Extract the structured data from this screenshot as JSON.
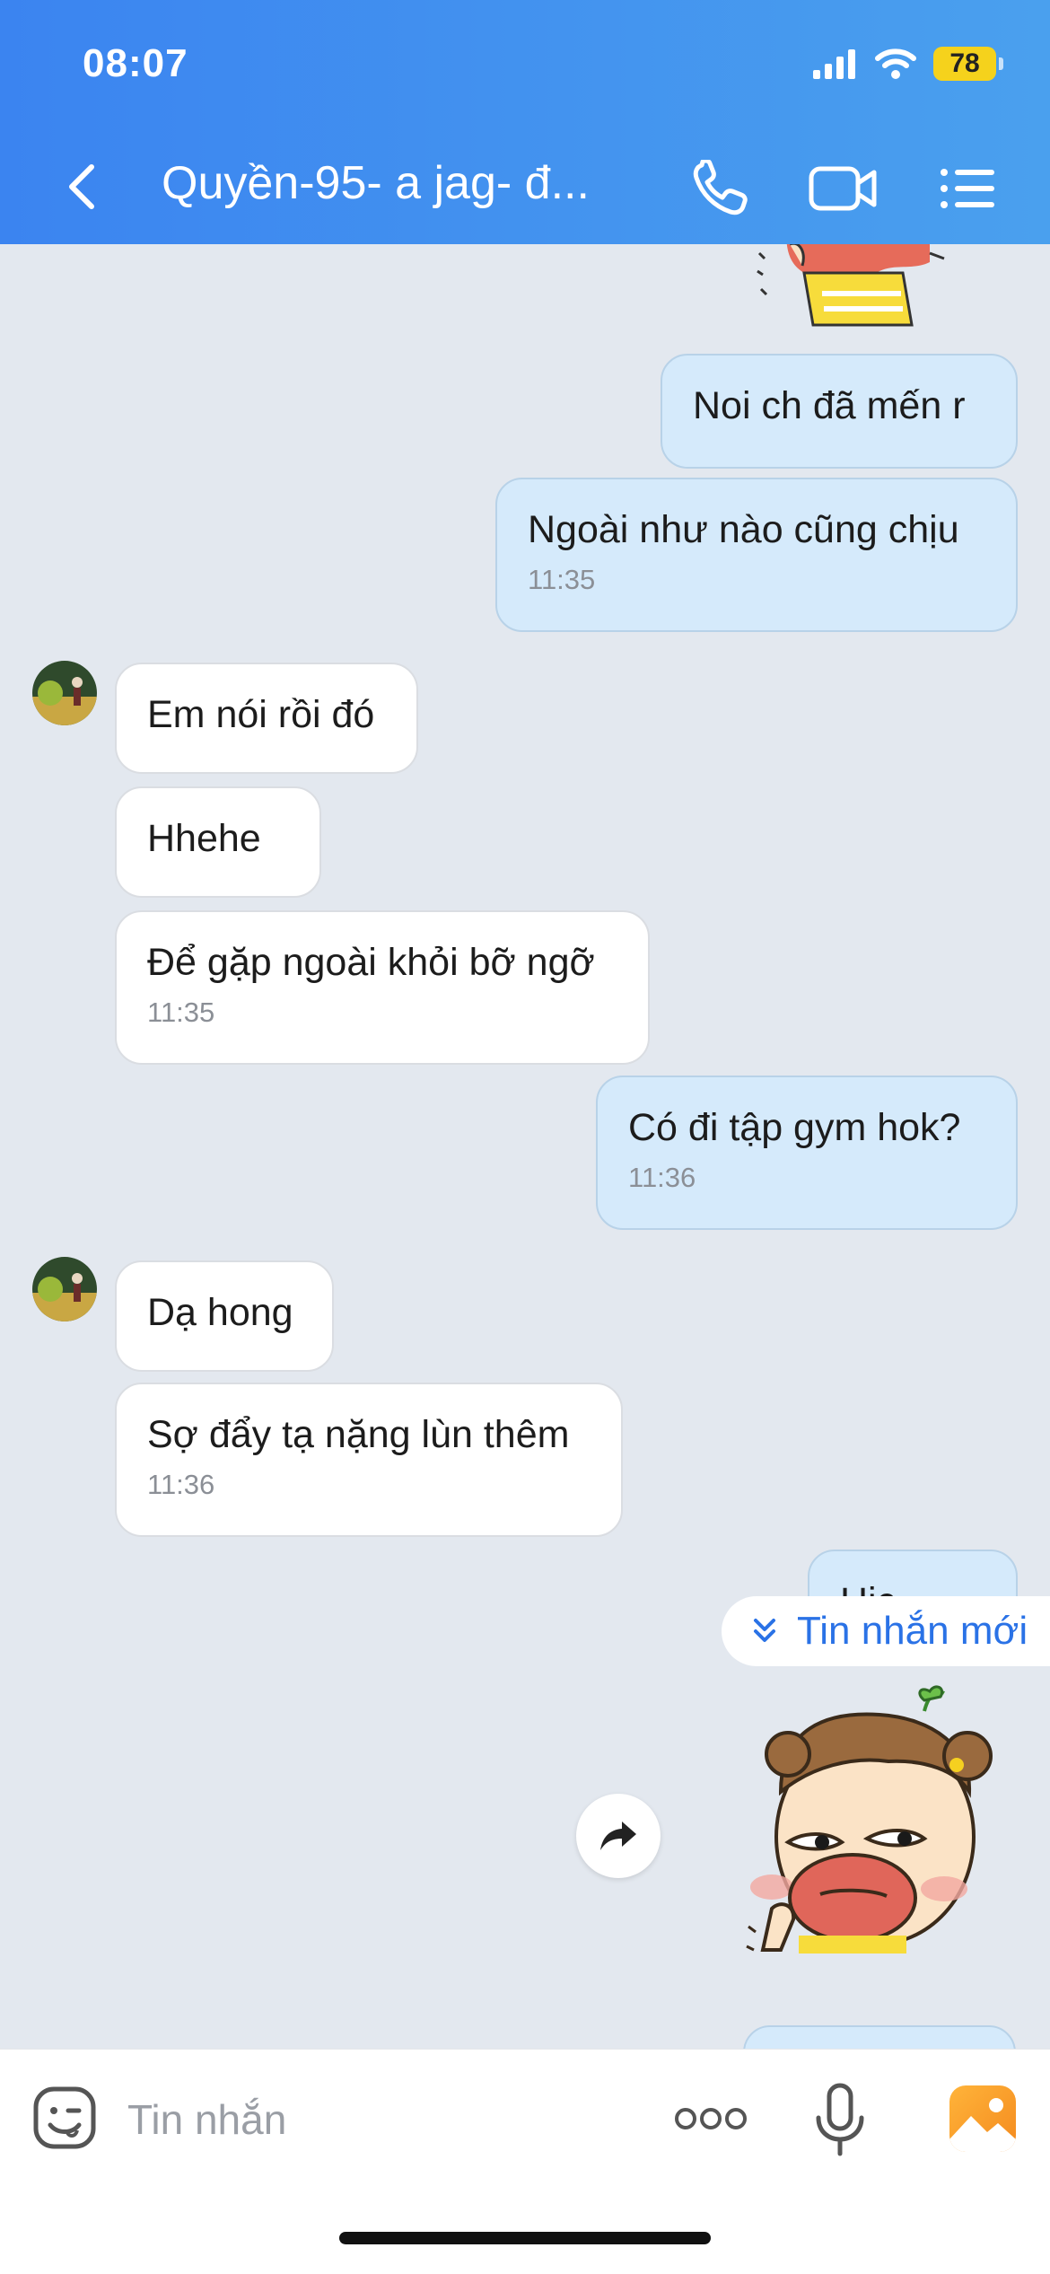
{
  "status_bar": {
    "time": "08:07",
    "battery": "78"
  },
  "header": {
    "title": "Quyền-95- a jag- đ...",
    "icons": [
      "back-chevron-icon",
      "phone-icon",
      "video-camera-icon",
      "list-menu-icon"
    ]
  },
  "messages": [
    {
      "side": "mine",
      "text": "Noi ch đã mến r"
    },
    {
      "side": "mine",
      "text": "Ngoài như nào cũng chịu",
      "time": "11:35"
    },
    {
      "side": "theirs",
      "text": "Em nói rồi đó"
    },
    {
      "side": "theirs",
      "text": "Hhehe"
    },
    {
      "side": "theirs",
      "text": "Để gặp ngoài khỏi bỡ ngỡ",
      "time": "11:35"
    },
    {
      "side": "mine",
      "text": "Có đi tập gym hok?",
      "time": "11:36"
    },
    {
      "side": "theirs",
      "text": "Dạ hong"
    },
    {
      "side": "theirs",
      "text": "Sợ đẩy tạ nặng lùn thêm",
      "time": "11:36"
    },
    {
      "side": "mine",
      "text": "Hic"
    }
  ],
  "new_messages_banner": {
    "label": "Tin nhắn mới",
    "icon": "double-chevron-down-icon"
  },
  "composer": {
    "placeholder": "Tin nhắn",
    "icons": [
      "emoji-sticker-icon",
      "more-dots-icon",
      "microphone-icon",
      "photo-gallery-icon"
    ]
  },
  "colors": {
    "header_gradient_start": "#3b84f0",
    "header_gradient_end": "#4aa0ee",
    "chat_background": "#e3e8ef",
    "mine_bubble": "#d5eafb",
    "theirs_bubble": "#ffffff",
    "accent": "#2a72e6"
  }
}
